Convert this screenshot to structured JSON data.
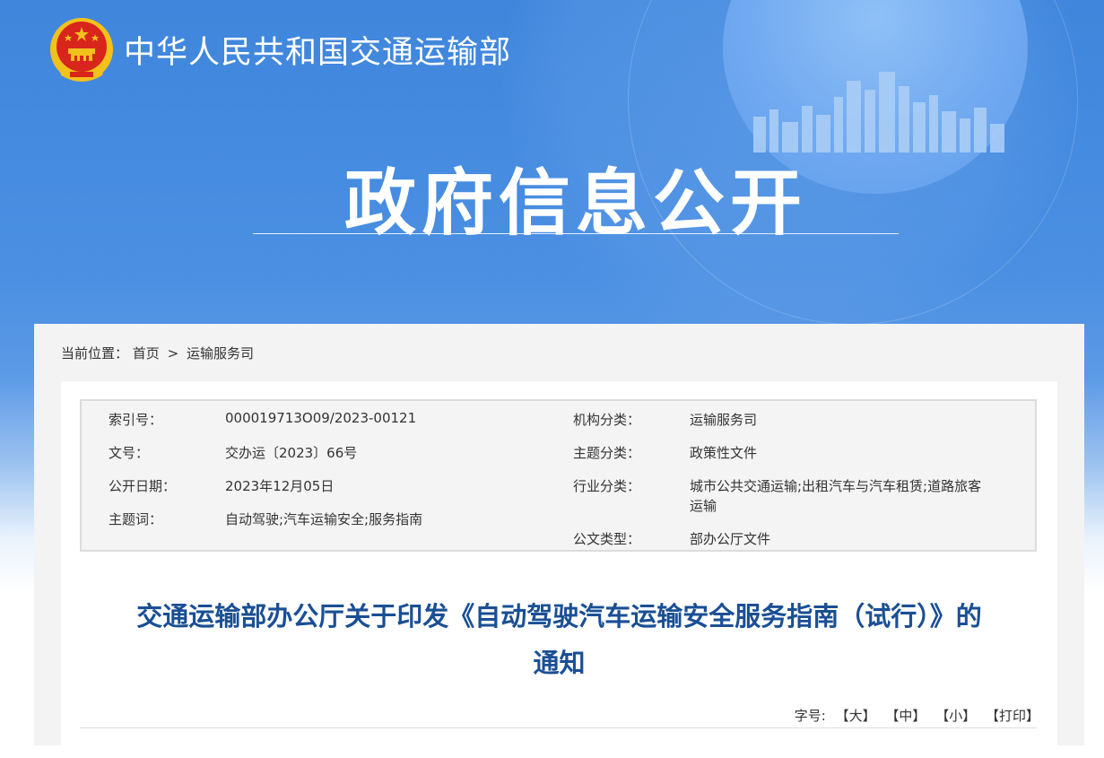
{
  "header": {
    "ministry_name": "中华人民共和国交通运输部",
    "section_title": "政府信息公开"
  },
  "breadcrumb": {
    "prefix": "当前位置：",
    "home": "首页",
    "separator": ">",
    "current": "运输服务司"
  },
  "metadata": {
    "index_label": "索引号：",
    "index_value": "000019713O09/2023-00121",
    "docno_label": "文号：",
    "docno_value": "交办运〔2023〕66号",
    "date_label": "公开日期：",
    "date_value": "2023年12月05日",
    "keywords_label": "主题词：",
    "keywords_value": "自动驾驶;汽车运输安全;服务指南",
    "org_label": "机构分类：",
    "org_value": "运输服务司",
    "topic_label": "主题分类：",
    "topic_value": "政策性文件",
    "industry_label": "行业分类：",
    "industry_value_line1": "城市公共交通运输;出租汽车与汽车租赁;道路旅客",
    "industry_value_line2": "运输",
    "doctype_label": "公文类型：",
    "doctype_value": "部办公厅文件"
  },
  "document": {
    "title_line1": "交通运输部办公厅关于印发《自动驾驶汽车运输安全服务指南（试行）》的",
    "title_line2": "通知"
  },
  "font_size_controls": {
    "label": "字号:",
    "large": "【大】",
    "medium": "【中】",
    "small": "【小】",
    "print": "【打印】"
  },
  "colors": {
    "banner_blue": "#4a8fe2",
    "title_blue": "#1a4f94",
    "emblem_red": "#d8261c",
    "emblem_gold": "#f3c11b"
  }
}
